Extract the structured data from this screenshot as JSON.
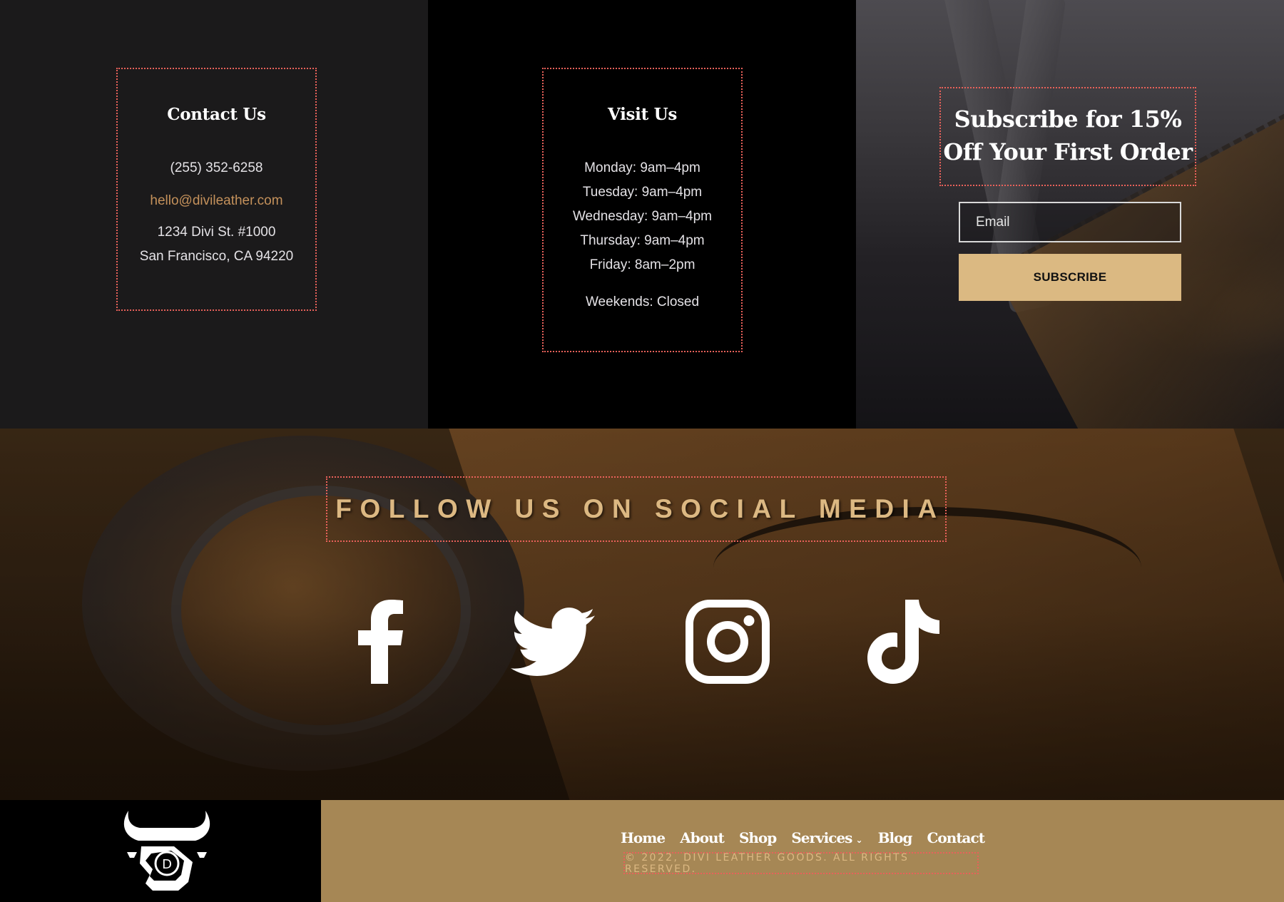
{
  "contact": {
    "title": "Contact Us",
    "phone": "(255) 352-6258",
    "email": "hello@divileather.com",
    "address_line1": "1234 Divi St. #1000",
    "address_line2": "San Francisco, CA 94220"
  },
  "visit": {
    "title": "Visit Us",
    "hours": [
      "Monday: 9am–4pm",
      "Tuesday: 9am–4pm",
      "Wednesday: 9am–4pm",
      "Thursday: 9am–4pm",
      "Friday: 8am–2pm"
    ],
    "weekends": "Weekends: Closed"
  },
  "subscribe": {
    "title_line1": "Subscribe for 15%",
    "title_line2": "Off Your First Order",
    "email_placeholder": "Email",
    "button_label": "SUBSCRIBE"
  },
  "social": {
    "heading": "FOLLOW US ON SOCIAL MEDIA",
    "icons": [
      "facebook-icon",
      "twitter-icon",
      "instagram-icon",
      "tiktok-icon"
    ]
  },
  "footer": {
    "nav": [
      {
        "label": "Home"
      },
      {
        "label": "About"
      },
      {
        "label": "Shop"
      },
      {
        "label": "Services",
        "has_submenu": true
      },
      {
        "label": "Blog"
      },
      {
        "label": "Contact"
      }
    ],
    "submenu_indicator": "⌄",
    "copyright": "© 2022, DIVI LEATHER GOODS. ALL RIGHTS RESERVED.",
    "logo_letter": "D"
  },
  "colors": {
    "accent_gold": "#dcb882",
    "button_gold": "#dbb982",
    "footer_bg": "#a68755",
    "email_link": "#c4915b",
    "dotted_border": "#e8615a"
  }
}
